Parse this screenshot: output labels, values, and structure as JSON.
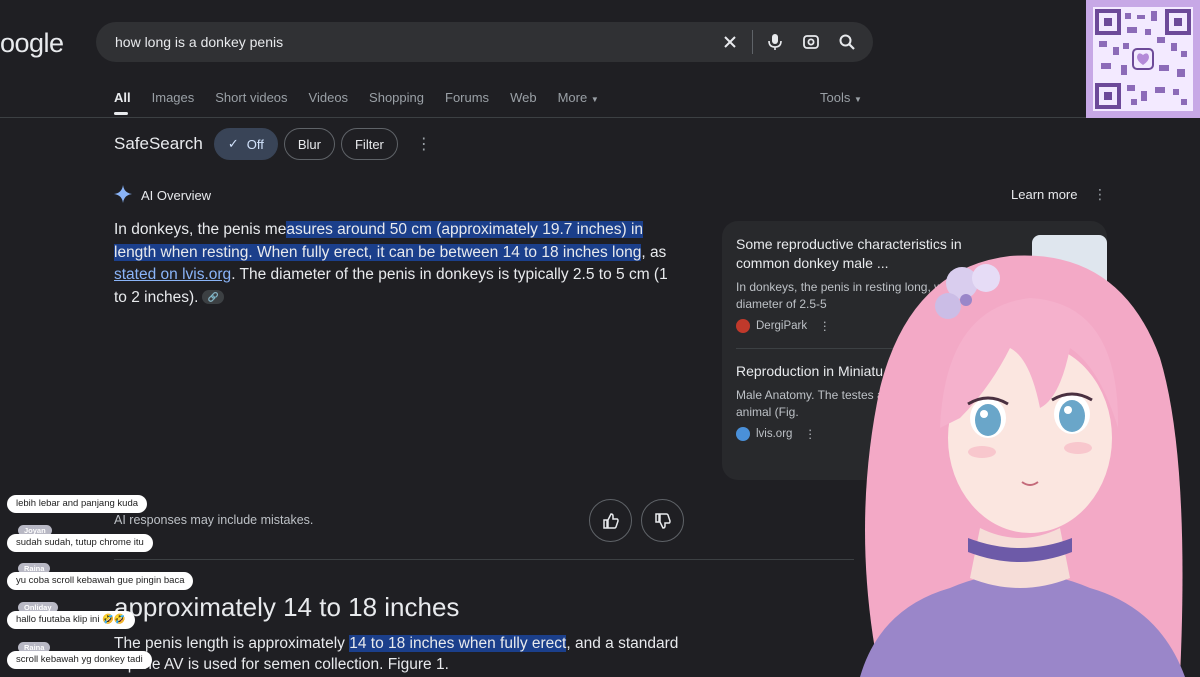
{
  "logo": "oogle",
  "search": {
    "query": "how long is a donkey penis",
    "clear_icon": "close-icon",
    "voice_icon": "mic-icon",
    "lens_icon": "camera-icon",
    "search_icon": "search-icon"
  },
  "tabs": [
    "All",
    "Images",
    "Short videos",
    "Videos",
    "Shopping",
    "Forums",
    "Web",
    "More"
  ],
  "tools_label": "Tools",
  "safesearch": {
    "label": "SafeSearch",
    "options": [
      "Off",
      "Blur",
      "Filter"
    ],
    "selected": "Off"
  },
  "ai_overview": {
    "title": "AI Overview",
    "learn_more": "Learn more",
    "text_parts": [
      "In donkeys, the penis me",
      "asures",
      " around 50 cm (approximately 19.7 inches) in length when resting.  When fully erect, it can be between 14 to 18 inches long",
      ", as ",
      "stated on lvis.org",
      ". The diameter of the penis in donkeys is typically 2.5 to 5 cm (1 to 2 inches)."
    ],
    "disclaimer": "AI responses may include mistakes."
  },
  "sources": [
    {
      "title": "Some reproductive characteristics in common donkey male ...",
      "desc": "In donkeys, the penis in resting long, with a diameter of 2.5-5",
      "site": "DergiPark"
    },
    {
      "title": "Reproduction in Miniatu lvis.org",
      "desc": "Male Anatomy. The testes a the size of the animal (Fig.",
      "site": "lvis.org"
    }
  ],
  "featured": {
    "heading": "approximately 14 to 18 inches",
    "snippet_parts": [
      "The penis length is approximately ",
      "14 to 18 inches when fully erect",
      ", and a standard equine AV is used for semen collection. Figure 1."
    ]
  },
  "chat": [
    {
      "name": "",
      "message": "lebih lebar and panjang kuda"
    },
    {
      "name": "Joyan",
      "message": "sudah sudah, tutup chrome itu"
    },
    {
      "name": "Raina",
      "message": "yu coba scroll kebawah gue pingin baca"
    },
    {
      "name": "Onliday",
      "message": "hallo fuutaba klip ini 🤣🤣"
    },
    {
      "name": "Raina",
      "message": "scroll kebawah yg donkey tadi"
    }
  ],
  "colors": {
    "background": "#1f1f23",
    "highlight": "#1b3f8b",
    "link": "#8ab4f8",
    "chip_selected": "#394457"
  }
}
